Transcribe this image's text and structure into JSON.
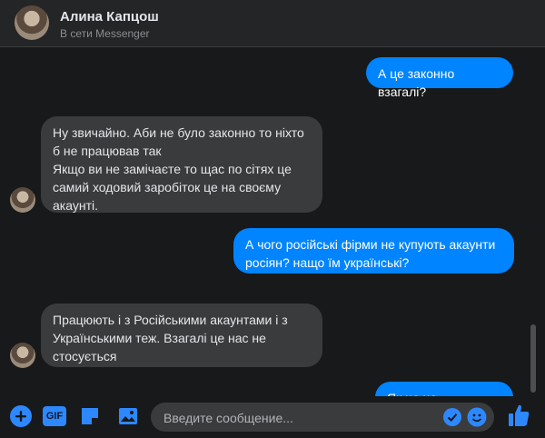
{
  "header": {
    "name": "Алина Капцош",
    "status": "В сети Messenger"
  },
  "messages": [
    {
      "from": "me",
      "text": "А це законно взагалі?"
    },
    {
      "from": "them",
      "text": "Ну звичайно. Аби не було законно то ніхто б не працював так\nЯкщо ви не замічаєте то щас по сітях це самий ходовий заробіток це на своєму акаунті."
    },
    {
      "from": "me",
      "text": "А чого російські фірми не купують акаунти росіян? нащо їм українські?"
    },
    {
      "from": "them",
      "text": "Працюють і з Російськими акаунтами і з Українськими теж. Взагалі це нас не стосується"
    },
    {
      "from": "me",
      "text": "Як це не стосується?"
    }
  ],
  "composer": {
    "placeholder": "Введите сообщение...",
    "gif_label": "GIF"
  },
  "colors": {
    "accent": "#0084ff",
    "background": "#18191a",
    "incoming_bubble": "#3a3b3c"
  }
}
